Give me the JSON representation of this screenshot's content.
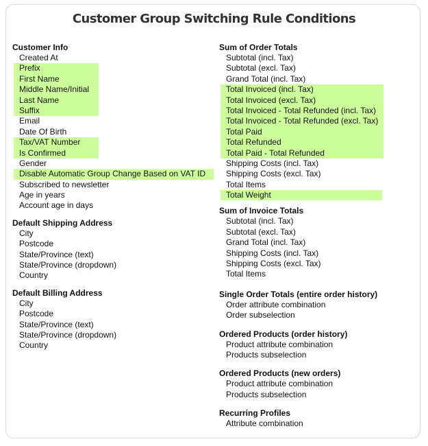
{
  "title": "Customer Group Switching Rule Conditions",
  "highlight_color": "#ccff99",
  "left_sections": [
    {
      "heading": "Customer Info",
      "items": [
        {
          "label": "Created At",
          "highlighted": false
        },
        {
          "label": "Prefix",
          "highlighted": true
        },
        {
          "label": "First Name",
          "highlighted": true
        },
        {
          "label": "Middle Name/Initial",
          "highlighted": true
        },
        {
          "label": "Last Name",
          "highlighted": true
        },
        {
          "label": "Suffix",
          "highlighted": true
        },
        {
          "label": "Email",
          "highlighted": false
        },
        {
          "label": "Date Of Birth",
          "highlighted": false
        },
        {
          "label": "Tax/VAT Number",
          "highlighted": true
        },
        {
          "label": "Is Confirmed",
          "highlighted": true
        },
        {
          "label": "Gender",
          "highlighted": false
        },
        {
          "label": "Disable Automatic Group Change Based on VAT ID",
          "highlighted": true
        },
        {
          "label": "Subscribed to newsletter",
          "highlighted": false
        },
        {
          "label": "Age in years",
          "highlighted": false
        },
        {
          "label": "Account age in days",
          "highlighted": false
        }
      ]
    },
    {
      "heading": "Default Shipping Address",
      "items": [
        {
          "label": "City",
          "highlighted": false
        },
        {
          "label": "Postcode",
          "highlighted": false
        },
        {
          "label": "State/Province (text)",
          "highlighted": false
        },
        {
          "label": "State/Province (dropdown)",
          "highlighted": false
        },
        {
          "label": "Country",
          "highlighted": false
        }
      ]
    },
    {
      "heading": "Default Billing Address",
      "items": [
        {
          "label": "City",
          "highlighted": false
        },
        {
          "label": "Postcode",
          "highlighted": false
        },
        {
          "label": "State/Province (text)",
          "highlighted": false
        },
        {
          "label": "State/Province (dropdown)",
          "highlighted": false
        },
        {
          "label": "Country",
          "highlighted": false
        }
      ]
    }
  ],
  "right_sections": [
    {
      "heading": "Sum of Order Totals",
      "items": [
        {
          "label": "Subtotal (incl. Tax)",
          "highlighted": false
        },
        {
          "label": "Subtotal (excl. Tax)",
          "highlighted": false
        },
        {
          "label": "Grand Total (incl. Tax)",
          "highlighted": false
        },
        {
          "label": "Total Invoiced (incl. Tax)",
          "highlighted": true
        },
        {
          "label": "Total Invoiced (excl. Tax)",
          "highlighted": true
        },
        {
          "label": "Total Invoiced - Total Refunded (incl. Tax)",
          "highlighted": true
        },
        {
          "label": "Total Invoiced - Total Refunded (excl. Tax)",
          "highlighted": true
        },
        {
          "label": "Total Paid",
          "highlighted": true
        },
        {
          "label": "Total Refunded",
          "highlighted": true
        },
        {
          "label": "Total Paid - Total Refunded",
          "highlighted": true
        },
        {
          "label": "Shipping Costs (incl. Tax)",
          "highlighted": false
        },
        {
          "label": "Shipping Costs (excl. Tax)",
          "highlighted": false
        },
        {
          "label": "Total Items",
          "highlighted": false
        },
        {
          "label": "Total Weight",
          "highlighted": true
        }
      ]
    },
    {
      "heading": "Sum of Invoice Totals",
      "items": [
        {
          "label": "Subtotal (incl. Tax)",
          "highlighted": false
        },
        {
          "label": "Subtotal (excl. Tax)",
          "highlighted": false
        },
        {
          "label": "Grand Total (incl. Tax)",
          "highlighted": false
        },
        {
          "label": "Shipping Costs (incl. Tax)",
          "highlighted": false
        },
        {
          "label": "Shipping Costs (excl. Tax)",
          "highlighted": false
        },
        {
          "label": "Total Items",
          "highlighted": false
        }
      ]
    },
    {
      "heading": "Single Order Totals (entire order history)",
      "items": [
        {
          "label": "Order attribute combination",
          "highlighted": false
        },
        {
          "label": "Order subselection",
          "highlighted": false
        }
      ]
    },
    {
      "heading": "Ordered Products (order history)",
      "items": [
        {
          "label": "Product attribute combination",
          "highlighted": false
        },
        {
          "label": "Products subselection",
          "highlighted": false
        }
      ]
    },
    {
      "heading": "Ordered Products (new orders)",
      "items": [
        {
          "label": "Product attribute combination",
          "highlighted": false
        },
        {
          "label": "Products subselection",
          "highlighted": false
        }
      ]
    },
    {
      "heading": "Recurring Profiles",
      "items": [
        {
          "label": "Attribute combination",
          "highlighted": false
        }
      ]
    }
  ]
}
